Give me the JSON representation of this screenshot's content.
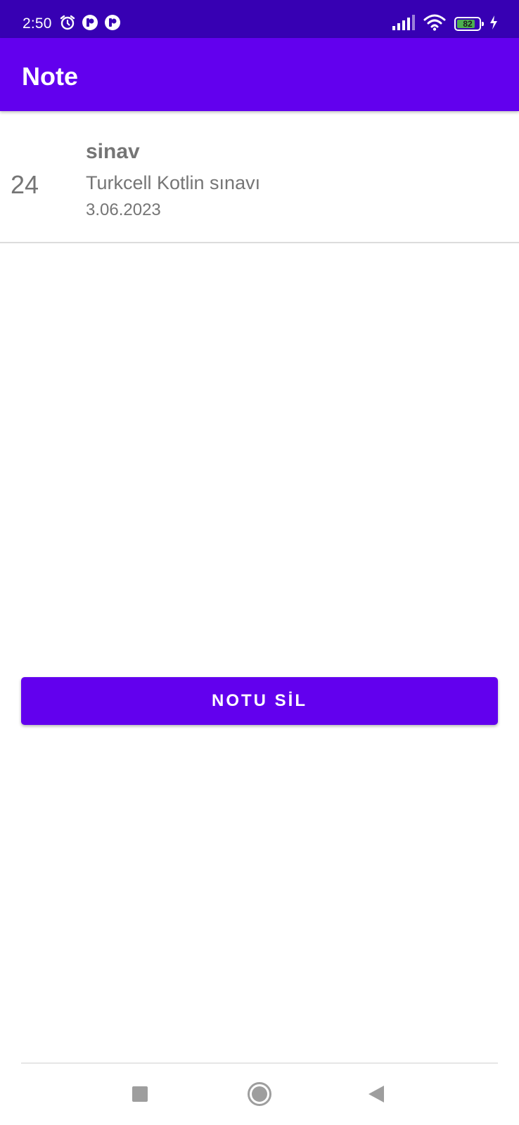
{
  "status_bar": {
    "time": "2:50",
    "battery_level": "82",
    "battery_percent": 82,
    "background_color": "#3700B3",
    "left_icons": [
      "alarm-icon",
      "notification-app-icon",
      "notification-app-icon"
    ],
    "right_icons": [
      "signal-icon",
      "wifi-icon",
      "battery-icon",
      "charging-icon"
    ]
  },
  "app_bar": {
    "title": "Note",
    "background_color": "#6200EE"
  },
  "note": {
    "id": "24",
    "title": "sinav",
    "description": "Turkcell Kotlin sınavı",
    "date": "3.06.2023"
  },
  "actions": {
    "delete_label": "NOTU SİL",
    "accent_color": "#6200EE"
  },
  "nav_bar": {
    "buttons": [
      "recents-icon",
      "home-icon",
      "back-icon"
    ]
  }
}
